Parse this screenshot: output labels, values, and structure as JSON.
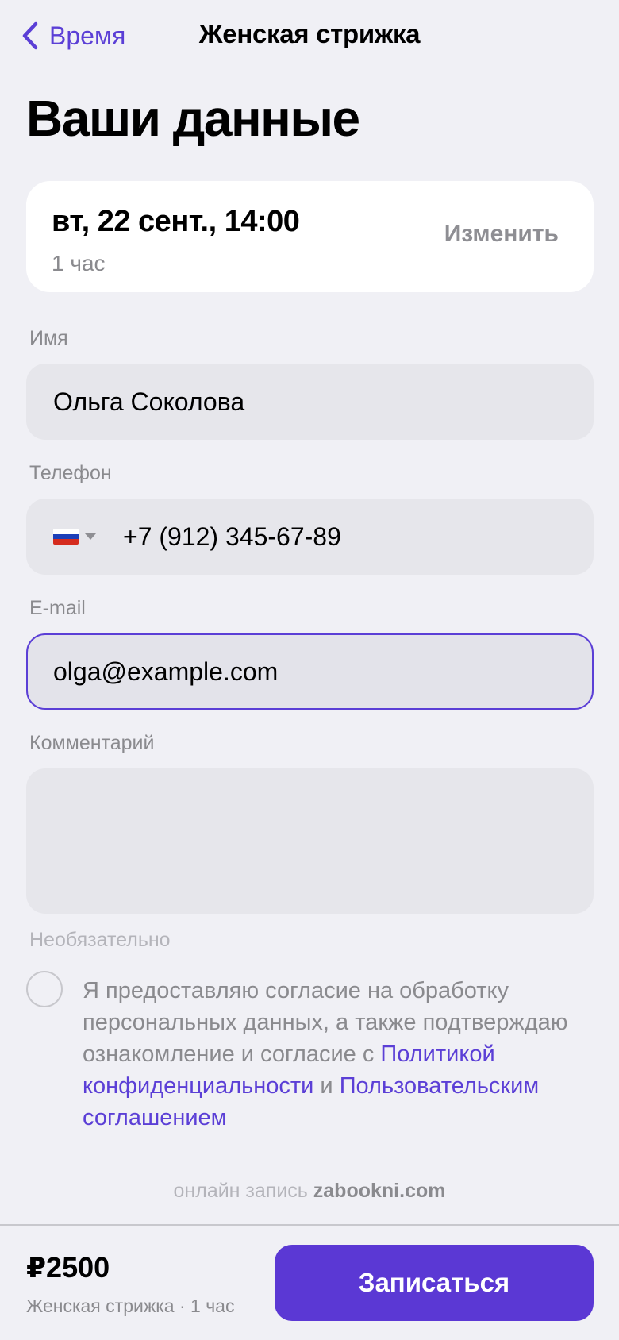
{
  "header": {
    "back_label": "Время",
    "title": "Женская стрижка"
  },
  "page_title": "Ваши данные",
  "appointment": {
    "date_time": "вт, 22 сент., 14:00",
    "duration": "1 час",
    "change_label": "Изменить"
  },
  "form": {
    "name": {
      "label": "Имя",
      "value": "Ольга Соколова"
    },
    "phone": {
      "label": "Телефон",
      "value": "+7 (912) 345-67-89",
      "country_flag": "russia-flag-icon"
    },
    "email": {
      "label": "E-mail",
      "value": "olga@example.com"
    },
    "comment": {
      "label": "Комментарий",
      "value": "",
      "hint": "Необязательно"
    }
  },
  "consent": {
    "checked": false,
    "text_before": "Я предоставляю согласие на обработку персональных данных, а также подтверждаю ознакомление и согласие с ",
    "privacy_link": "Политикой конфиденциальности",
    "joiner": " и ",
    "terms_link": "Пользовательским соглашением"
  },
  "powered_by": {
    "prefix": "онлайн запись ",
    "brand": "zabookni.com"
  },
  "footer": {
    "price": "₽2500",
    "summary": "Женская стрижка · 1 час",
    "cta_label": "Записаться"
  },
  "colors": {
    "accent": "#5b3fd6",
    "background": "#f0f0f5",
    "field": "#e6e6eb"
  }
}
